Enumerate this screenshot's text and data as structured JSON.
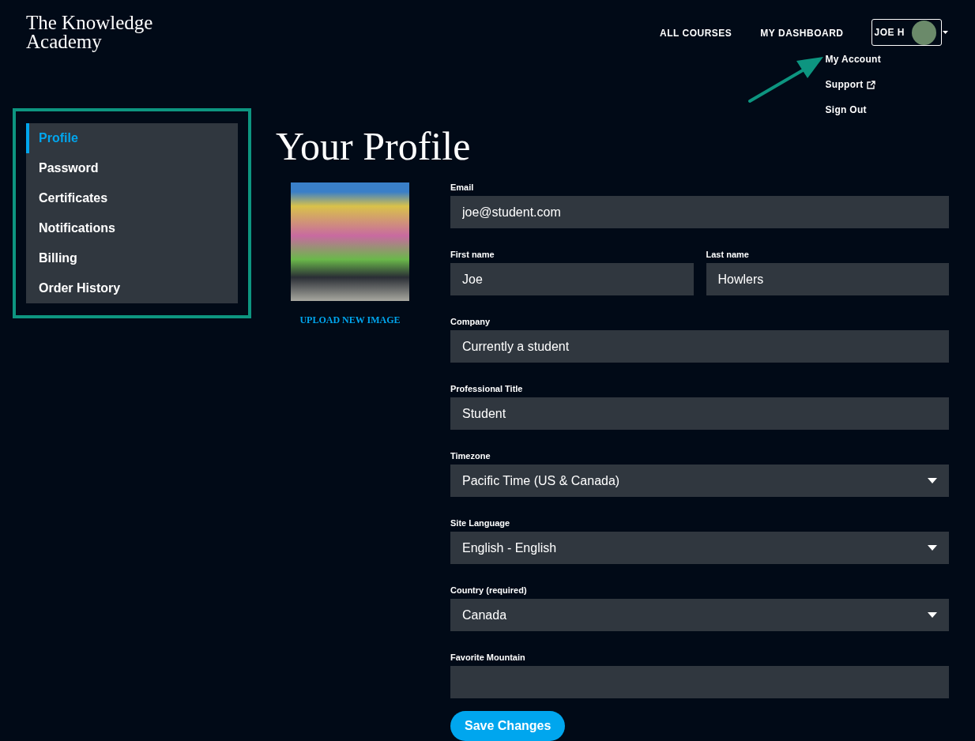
{
  "header": {
    "logo_lines": [
      "The Knowledge",
      "Academy"
    ],
    "nav": [
      "ALL COURSES",
      "MY DASHBOARD"
    ],
    "user": {
      "label": "JOE H"
    },
    "menu": [
      {
        "label": "My Account",
        "external": false
      },
      {
        "label": "Support",
        "external": true
      },
      {
        "label": "Sign Out",
        "external": false
      }
    ]
  },
  "sidebar": {
    "items": [
      {
        "label": "Profile",
        "selected": true
      },
      {
        "label": "Password",
        "selected": false
      },
      {
        "label": "Certificates",
        "selected": false
      },
      {
        "label": "Notifications",
        "selected": false
      },
      {
        "label": "Billing",
        "selected": false
      },
      {
        "label": "Order History",
        "selected": false
      }
    ]
  },
  "title": "Your Profile",
  "photo": {
    "action": "UPLOAD NEW IMAGE"
  },
  "form": {
    "rows": [
      [
        {
          "label": "Email",
          "value": "joe@student.com",
          "kind": "text"
        }
      ],
      [
        {
          "label": "First name",
          "value": "Joe",
          "kind": "text"
        },
        {
          "label": "Last name",
          "value": "Howlers",
          "kind": "text"
        }
      ],
      [
        {
          "label": "Company",
          "value": "Currently a student",
          "kind": "text"
        }
      ],
      [
        {
          "label": "Professional Title",
          "value": "Student",
          "kind": "text"
        }
      ],
      [
        {
          "label": "Timezone",
          "value": "Pacific Time (US & Canada)",
          "kind": "select"
        }
      ],
      [
        {
          "label": "Site Language",
          "value": "English - English",
          "kind": "select"
        }
      ],
      [
        {
          "label": "Country (required)",
          "value": "Canada",
          "kind": "select"
        }
      ],
      [
        {
          "label": "Favorite Mountain",
          "kind": "text"
        }
      ]
    ],
    "submit": "Save Changes"
  }
}
